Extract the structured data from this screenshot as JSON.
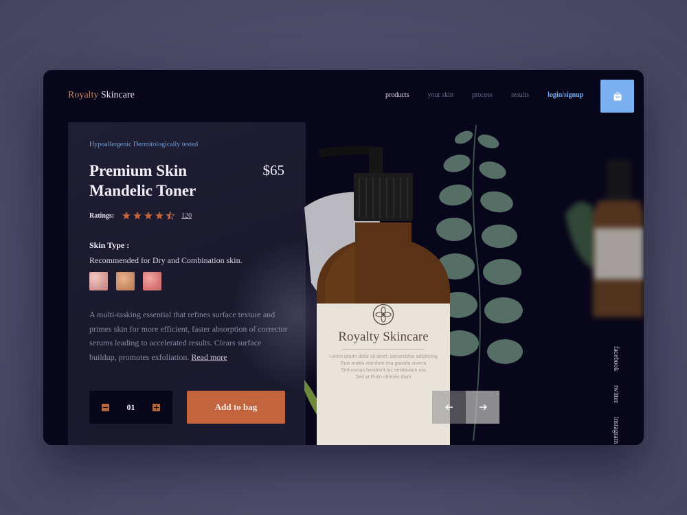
{
  "brand": {
    "part1": "Royalty",
    "part2": "Skincare"
  },
  "nav": {
    "items": [
      {
        "label": "products"
      },
      {
        "label": "your skin"
      },
      {
        "label": "process"
      },
      {
        "label": "results"
      }
    ],
    "login_label": "login/signup"
  },
  "product": {
    "tagline": "Hypoallergenic Dermitologically tested",
    "title_line1": "Premium Skin",
    "title_line2": "Mandelic Toner",
    "price": "$65",
    "ratings_label": "Ratings:",
    "rating_value": 4.5,
    "rating_max": 5,
    "ratings_count": "120",
    "skin_type_heading": "Skin Type :",
    "skin_type_desc": "Recommended for Dry and Combination skin.",
    "description": "A multi-tasking essential that refines surface texture and primes skin for more efficient, faster absorption of corrector serums leading to accelerated results. Clears surface buildup, promotes exfoliation.",
    "read_more": "Read more",
    "quantity": "01",
    "add_to_bag": "Add to bag"
  },
  "bottle_label": {
    "brand": "Royalty Skincare",
    "fine_print": [
      "Lorem ipsum dolor sit amet, consectetur adipiscing",
      "Duis mattis interdum exa gravida viverra",
      "Sed cursus hendrerit mi, vestibulum nisi",
      "Sed at Proin ultricies diam"
    ]
  },
  "social": [
    {
      "label": "facebook"
    },
    {
      "label": "twitter"
    },
    {
      "label": "instagram"
    }
  ],
  "colors": {
    "accent": "#c2643e",
    "accent_star": "#c2643e",
    "link_blue": "#7aaff0",
    "panel_bg": "#07061a",
    "card_bg": "#1f1e34"
  },
  "icons": {
    "bag": "shopping-bag-icon",
    "prev": "arrow-left-icon",
    "next": "arrow-right-icon"
  }
}
